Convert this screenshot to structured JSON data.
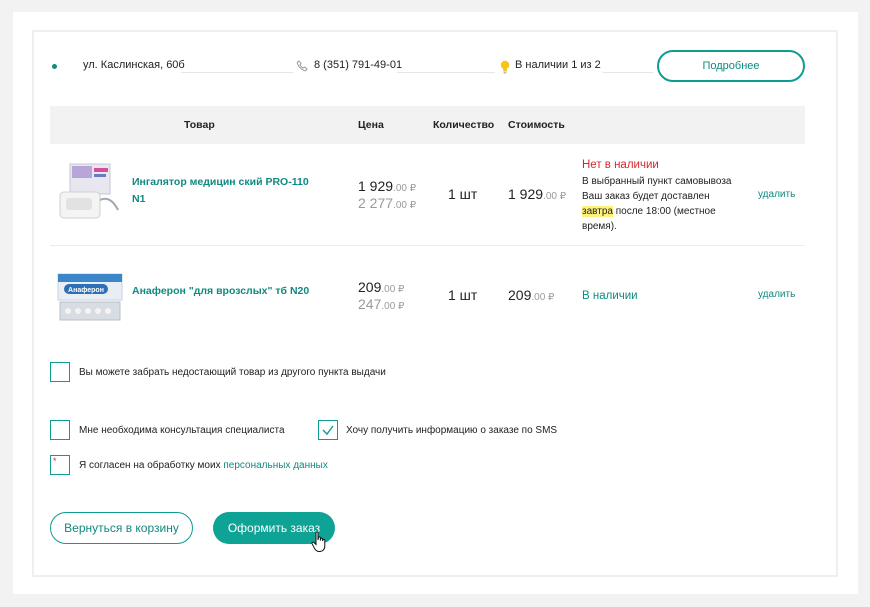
{
  "pickup": {
    "address": "ул. Каслинская, 60б",
    "phone": "8 (351) 791-49-01",
    "availability": "В наличии 1 из 2",
    "more_label": "Подробнее"
  },
  "table": {
    "headers": [
      "Товар",
      "Цена",
      "Количество",
      "Стоимость"
    ]
  },
  "items": [
    {
      "name_line1": "Ингалятор медицин ский PRO-110",
      "name_line2": "N1",
      "price_main": "1 929",
      "price_main_kop": ".00 ₽",
      "price_old": "2 277",
      "price_old_kop": ".00 ₽",
      "qty": "1 шт",
      "cost": "1 929",
      "cost_kop": ".00 ₽",
      "status": "Нет в наличии",
      "status_line1": "В выбранный пункт самовывоза",
      "status_line2": "Ваш заказ будет доставлен",
      "status_hl": "завтра",
      "status_line3_rest": " после 18:00 (местное",
      "status_line4": "время).",
      "delete_label": "удалить"
    },
    {
      "name_line1": "Анаферон \"для врозслых\" тб N20",
      "price_main": "209",
      "price_main_kop": ".00 ₽",
      "price_old": "247",
      "price_old_kop": ".00 ₽",
      "qty": "1 шт",
      "cost": "209",
      "cost_kop": ".00 ₽",
      "status": "В наличии",
      "delete_label": "удалить",
      "box_text": "Анаферон"
    }
  ],
  "options": {
    "other_point": "Вы можете забрать недостающий товар из другого пункта выдачи",
    "consultation": "Мне необходима консультация специалиста",
    "sms": "Хочу получить информацию о заказе по SMS",
    "consent_prefix": "Я согласен на обработку моих ",
    "consent_link": "персональных данных",
    "required_mark": "*"
  },
  "actions": {
    "back_label": "Вернуться в корзину",
    "order_label": "Оформить заказ"
  },
  "colors": {
    "accent": "#0f9c90",
    "error": "#d9262c",
    "highlight": "#fff27a"
  }
}
